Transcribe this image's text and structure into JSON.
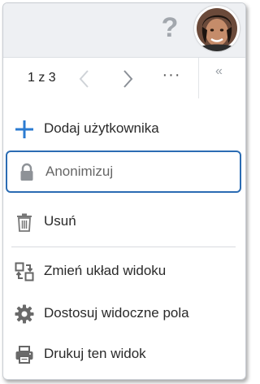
{
  "header": {
    "help_icon": "question-mark-icon",
    "avatar_icon": "user-avatar"
  },
  "pager": {
    "current": "1",
    "separator": "z",
    "total": "3",
    "text": "1 z 3",
    "prev_icon": "chevron-left-icon",
    "next_icon": "chevron-right-icon",
    "more_label": "···",
    "collapse_label": "«"
  },
  "menu": {
    "items": [
      {
        "label": "Dodaj użytkownika",
        "icon": "plus-icon",
        "color": "#2b7bd1"
      },
      {
        "label": "Anonimizuj",
        "icon": "lock-icon",
        "highlighted": true
      },
      {
        "label": "Usuń",
        "icon": "trash-icon"
      },
      {
        "label": "Zmień układ widoku",
        "icon": "layout-switch-icon"
      },
      {
        "label": "Dostosuj widoczne pola",
        "icon": "gear-icon"
      },
      {
        "label": "Drukuj ten widok",
        "icon": "printer-icon"
      }
    ]
  },
  "colors": {
    "accent": "#2b6cb3",
    "topbar_bg": "#eef0f3",
    "icon_gray": "#666666"
  }
}
